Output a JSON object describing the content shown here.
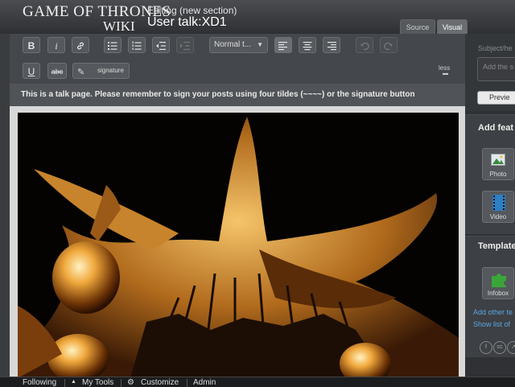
{
  "header": {
    "logo_line1": "GAME OF THRONES",
    "logo_line2": "WIKI",
    "editing_label": "Editing (new section)",
    "page_title": "User talk:XD1",
    "mode_tabs": [
      "Source",
      "Visual"
    ],
    "active_mode": "Visual"
  },
  "toolbar": {
    "bold_label": "B",
    "italic_label": "i",
    "format_select": "Normal t...",
    "underline_label": "U",
    "strike_label": "abc",
    "signature_label": "signature",
    "less_label": "less"
  },
  "notice": {
    "text": "This is a talk page. Please remember to sign your posts using four tildes (~~~~) or the signature button"
  },
  "rail": {
    "subject_label": "Subject/he",
    "subject_placeholder": "Add the s",
    "preview_label": "Previe",
    "add_features_title": "Add feat",
    "photo_label": "Photo",
    "video_label": "Video",
    "templates_title": "Template",
    "infobox_label": "Infobox",
    "add_other_link": "Add other te",
    "show_list_link": "Show list of",
    "social_icons": [
      "facebook-icon",
      "creative-commons-icon",
      "share-icon"
    ]
  },
  "footer": {
    "items": [
      "Following",
      "My Tools",
      "Customize",
      "Admin"
    ]
  },
  "colors": {
    "toolbar_bg": "#44474b",
    "link": "#5aa7e6",
    "footer_bg": "#1c1d1f"
  }
}
